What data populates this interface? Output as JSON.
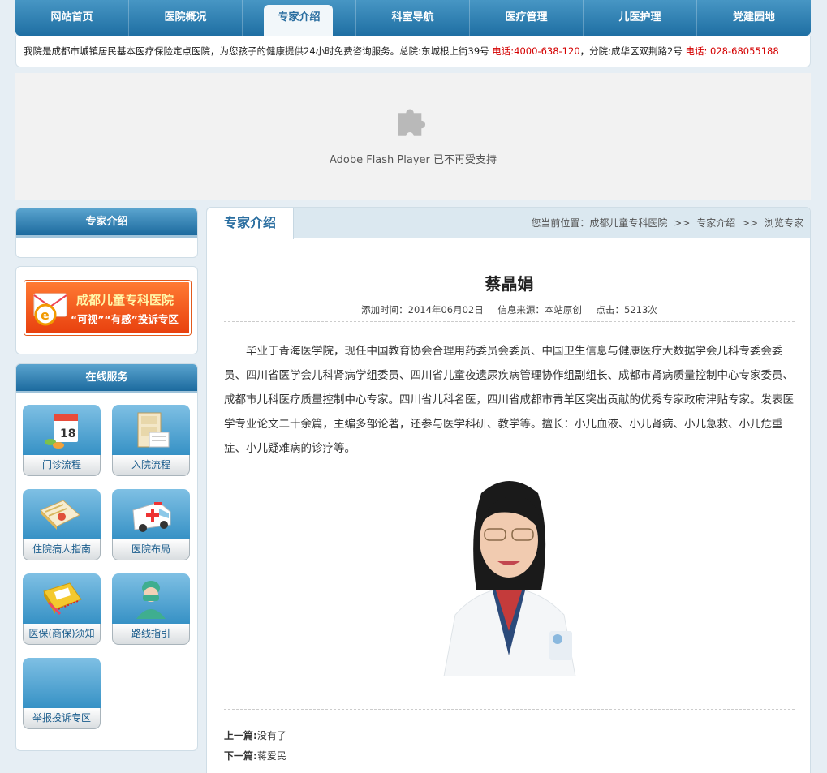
{
  "nav": {
    "items": [
      "网站首页",
      "医院概况",
      "专家介绍",
      "科室导航",
      "医疗管理",
      "儿医护理",
      "党建园地"
    ],
    "active_index": 2
  },
  "notice": {
    "text1": "我院是成都市城镇居民基本医疗保险定点医院，为您孩子的健康提供24小时免费咨询服务。总院:东城根上街39号 ",
    "phone1": "电话:4000-638-120",
    "text2": "，分院:成华区双荆路2号 ",
    "phone2": "电话: 028-68055188"
  },
  "flash": {
    "icon": "puzzle-plugin-icon",
    "text": "Adobe Flash Player 已不再受支持"
  },
  "sidebar": {
    "expert_box_title": "专家介绍",
    "banner": {
      "line1": "成都儿童专科医院",
      "line2": "“可视”“有感”投诉专区",
      "icon": "envelope-e-icon"
    },
    "service_title": "在线服务",
    "services": [
      {
        "label": "门诊流程",
        "icon": "calendar-pills-icon"
      },
      {
        "label": "入院流程",
        "icon": "cabinet-form-icon"
      },
      {
        "label": "住院病人指南",
        "icon": "document-book-icon"
      },
      {
        "label": "医院布局",
        "icon": "ambulance-icon"
      },
      {
        "label": "医保(商保)须知",
        "icon": "id-card-icon"
      },
      {
        "label": "路线指引",
        "icon": "doctor-mask-icon"
      },
      {
        "label": "举报投诉专区",
        "icon": ""
      }
    ]
  },
  "main": {
    "tab": "专家介绍",
    "breadcrumb": {
      "prefix": "您当前位置：",
      "items": [
        "成都儿童专科医院",
        "专家介绍",
        "浏览专家"
      ],
      "separator": ">>"
    },
    "title": "蔡晶娟",
    "meta": {
      "added": "添加时间：2014年06月02日",
      "source": "信息来源：本站原创",
      "clicks": "点击：5213次"
    },
    "body": "毕业于青海医学院，现任中国教育协会合理用药委员会委员、中国卫生信息与健康医疗大数据学会儿科专委会委员、四川省医学会儿科肾病学组委员、四川省儿童夜遗尿疾病管理协作组副组长、成都市肾病质量控制中心专家委员、成都市儿科医疗质量控制中心专家。四川省儿科名医，四川省成都市青羊区突出贡献的优秀专家政府津贴专家。发表医学专业论文二十余篇，主编多部论著，还参与医学科研、教学等。擅长：小儿血液、小儿肾病、小儿急救、小儿危重症、小儿疑难病的诊疗等。",
    "prev_label": "上一篇:",
    "prev_value": "没有了",
    "next_label": "下一篇:",
    "next_value": "蒋爱民"
  },
  "colors": {
    "nav_top": "#4796c4",
    "nav_bottom": "#1f6fa3",
    "phone_red": "#d40000",
    "link_blue": "#2a6ea0"
  }
}
